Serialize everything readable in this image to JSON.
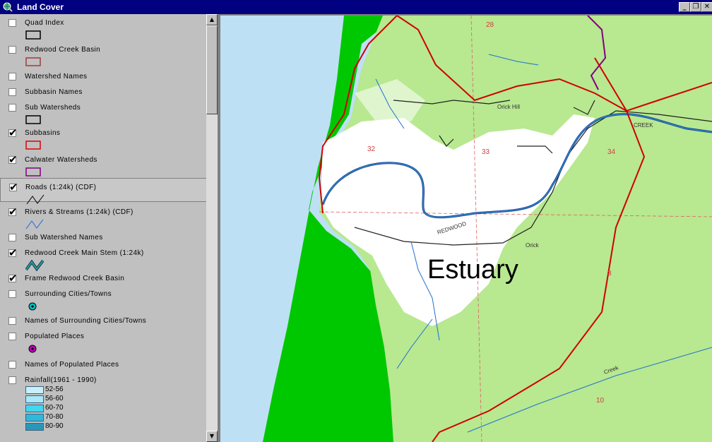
{
  "window": {
    "title": "Land Cover",
    "controls": [
      "_",
      "❐",
      "✕"
    ]
  },
  "layers": [
    {
      "name": "Quad Index",
      "checked": false,
      "symbol": "rect",
      "color": "#000000"
    },
    {
      "name": "Redwood Creek Basin",
      "checked": false,
      "symbol": "rect",
      "color": "#a03c3c"
    },
    {
      "name": "Watershed Names",
      "checked": false,
      "symbol": "none"
    },
    {
      "name": "Subbasin Names",
      "checked": false,
      "symbol": "none"
    },
    {
      "name": "Sub Watersheds",
      "checked": false,
      "symbol": "rect",
      "color": "#000000"
    },
    {
      "name": "Subbasins",
      "checked": true,
      "symbol": "rect",
      "color": "#e00000"
    },
    {
      "name": "Calwater Watersheds",
      "checked": true,
      "symbol": "rect",
      "color": "#800080"
    },
    {
      "name": "Roads (1:24k) (CDF)",
      "checked": true,
      "symbol": "line",
      "color": "#000000",
      "selected": true
    },
    {
      "name": "Rivers & Streams (1:24k) (CDF)",
      "checked": true,
      "symbol": "line",
      "color": "#3c78d8"
    },
    {
      "name": "Sub Watershed Names",
      "checked": false,
      "symbol": "none"
    },
    {
      "name": "Redwood Creek Main Stem (1:24k)",
      "checked": true,
      "symbol": "zigzag",
      "color": "#20a0a0"
    },
    {
      "name": "Frame Redwood Creek Basin",
      "checked": true,
      "symbol": "none"
    },
    {
      "name": "Surrounding Cities/Towns",
      "checked": false,
      "symbol": "dot",
      "color": "#00c0c0"
    },
    {
      "name": "Names of Surrounding Cities/Towns",
      "checked": false,
      "symbol": "none"
    },
    {
      "name": "Populated Places",
      "checked": false,
      "symbol": "dot",
      "color": "#c000c0"
    },
    {
      "name": "Names of Populated Places",
      "checked": false,
      "symbol": "none"
    },
    {
      "name": "Rainfall(1961 - 1990)",
      "checked": false,
      "symbol": "none"
    }
  ],
  "rainfall_classes": [
    {
      "label": "52-56",
      "color": "#c8f0f8"
    },
    {
      "label": "56-60",
      "color": "#a8e8f8"
    },
    {
      "label": "60-70",
      "color": "#40d8f0"
    },
    {
      "label": "70-80",
      "color": "#30b8d8"
    },
    {
      "label": "80-90",
      "color": "#2898b8"
    }
  ],
  "map": {
    "label": "Estuary",
    "section_numbers": [
      "28",
      "32",
      "33",
      "34",
      "3",
      "10"
    ],
    "place_labels": [
      "Orick",
      "Orick Hill",
      "REDWOOD",
      "Creek",
      "CREEK"
    ],
    "colors": {
      "ocean": "#bee0f4",
      "forest": "#b8e890",
      "open": "#ffffff",
      "beach": "#00c800",
      "boundary": "#d00000",
      "river": "#1040a0"
    }
  }
}
